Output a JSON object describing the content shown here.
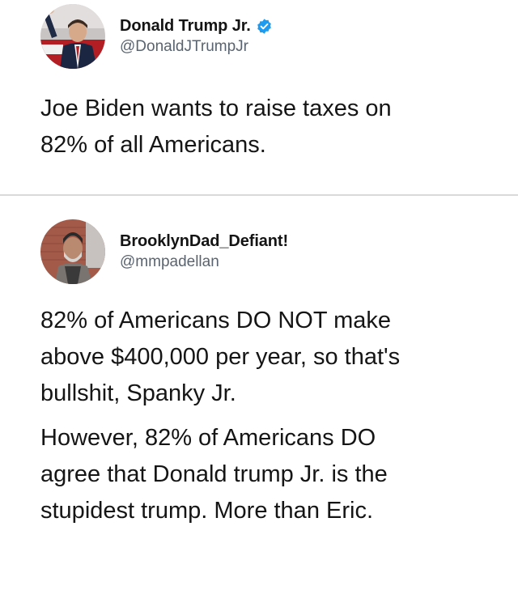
{
  "tweets": [
    {
      "display_name": "Donald Trump Jr.",
      "handle": "@DonaldJTrumpJr",
      "verified": true,
      "avatar_icon": "profile-photo-icon",
      "text_lines": [
        "Joe Biden wants to raise taxes on",
        "82% of all Americans."
      ]
    },
    {
      "display_name": "BrooklynDad_Defiant!",
      "handle": "@mmpadellan",
      "verified": false,
      "avatar_icon": "profile-photo-icon",
      "paragraph_1": [
        "82% of Americans DO NOT make",
        "above $400,000 per year, so that's",
        "bullshit, Spanky Jr."
      ],
      "paragraph_2": [
        "However, 82% of Americans DO",
        "agree that Donald trump Jr. is the",
        "stupidest trump. More than Eric."
      ]
    }
  ],
  "colors": {
    "verified_badge": "#1d9bf0",
    "handle_text": "#5a6470",
    "divider": "#d9d9d9"
  }
}
